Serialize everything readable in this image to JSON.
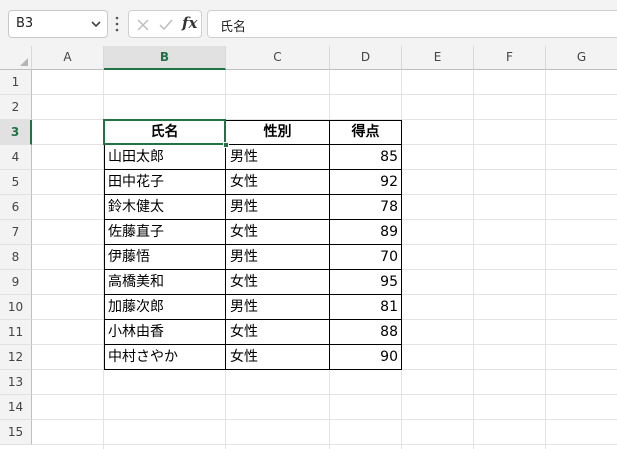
{
  "formula_bar": {
    "name_box": "B3",
    "fx_label": "fx",
    "formula": "氏名"
  },
  "columns": [
    "A",
    "B",
    "C",
    "D",
    "E",
    "F",
    "G"
  ],
  "rows": [
    "1",
    "2",
    "3",
    "4",
    "5",
    "6",
    "7",
    "8",
    "9",
    "10",
    "11",
    "12",
    "13",
    "14",
    "15"
  ],
  "selected_cell": "B3",
  "table": {
    "headers": [
      "氏名",
      "性別",
      "得点"
    ],
    "rows": [
      [
        "山田太郎",
        "男性",
        "85"
      ],
      [
        "田中花子",
        "女性",
        "92"
      ],
      [
        "鈴木健太",
        "男性",
        "78"
      ],
      [
        "佐藤直子",
        "女性",
        "89"
      ],
      [
        "伊藤悟",
        "男性",
        "70"
      ],
      [
        "高橋美和",
        "女性",
        "95"
      ],
      [
        "加藤次郎",
        "男性",
        "81"
      ],
      [
        "小林由香",
        "女性",
        "88"
      ],
      [
        "中村さやか",
        "女性",
        "90"
      ]
    ]
  },
  "colors": {
    "selection": "#217346",
    "header_bg": "#f3f3f3",
    "gridline": "#e3e3e3"
  }
}
